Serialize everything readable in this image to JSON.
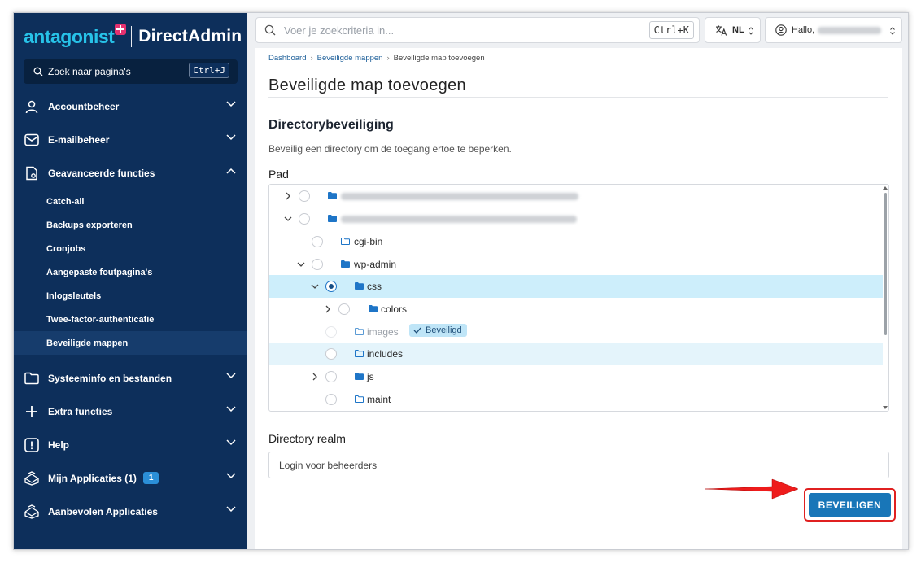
{
  "brand": {
    "logo_text": "antagonist",
    "product": "DirectAdmin"
  },
  "sidebar": {
    "search_label": "Zoek naar pagina's",
    "search_shortcut": "Ctrl+J",
    "items": [
      {
        "label": "Accountbeheer",
        "icon": "user-icon"
      },
      {
        "label": "E-mailbeheer",
        "icon": "mail-icon"
      },
      {
        "label": "Geavanceerde functies",
        "icon": "advanced-icon",
        "expanded": true,
        "children": [
          "Catch-all",
          "Backups exporteren",
          "Cronjobs",
          "Aangepaste foutpagina's",
          "Inlogsleutels",
          "Twee-factor-authenticatie",
          "Beveiligde mappen"
        ]
      },
      {
        "label": "Systeeminfo en bestanden",
        "icon": "folder-icon"
      },
      {
        "label": "Extra functies",
        "icon": "plus-icon"
      },
      {
        "label": "Help",
        "icon": "help-icon"
      },
      {
        "label": "Mijn Applicaties (1)",
        "icon": "apps-icon",
        "badge": "1"
      },
      {
        "label": "Aanbevolen Applicaties",
        "icon": "apps-icon"
      }
    ],
    "active_child": "Beveiligde mappen"
  },
  "topbar": {
    "search_placeholder": "Voer je zoekcriteria in...",
    "search_shortcut": "Ctrl+K",
    "language": "NL",
    "greeting": "Hallo,"
  },
  "breadcrumb": [
    "Dashboard",
    "Beveiligde mappen",
    "Beveiligde map toevoegen"
  ],
  "page": {
    "title": "Beveiligde map toevoegen",
    "section_title": "Directorybeveiliging",
    "section_desc": "Beveilig een directory om de toegang ertoe te beperken.",
    "path_label": "Pad",
    "tree": [
      {
        "name": "",
        "blurred": true,
        "depth": 0,
        "caret": "right"
      },
      {
        "name": "",
        "blurred": true,
        "depth": 0,
        "caret": "down"
      },
      {
        "name": "cgi-bin",
        "depth": 1,
        "caret": "none"
      },
      {
        "name": "wp-admin",
        "depth": 1,
        "caret": "down"
      },
      {
        "name": "css",
        "depth": 2,
        "caret": "down",
        "selected": true
      },
      {
        "name": "colors",
        "depth": 3,
        "caret": "right"
      },
      {
        "name": "images",
        "depth": 2,
        "caret": "none",
        "disabled": true,
        "badge": "Beveiligd"
      },
      {
        "name": "includes",
        "depth": 2,
        "caret": "none",
        "hover": true
      },
      {
        "name": "js",
        "depth": 2,
        "caret": "right"
      },
      {
        "name": "maint",
        "depth": 2,
        "caret": "none"
      }
    ],
    "realm_label": "Directory realm",
    "realm_value": "Login voor beheerders",
    "submit_label": "BEVEILIGEN"
  },
  "colors": {
    "sidebar": "#0d2f5b",
    "accent": "#1876b8",
    "selected_row": "#cdeefb",
    "highlight": "#e02020",
    "brand_cyan": "#27c2e8",
    "brand_pink": "#e5316f"
  }
}
